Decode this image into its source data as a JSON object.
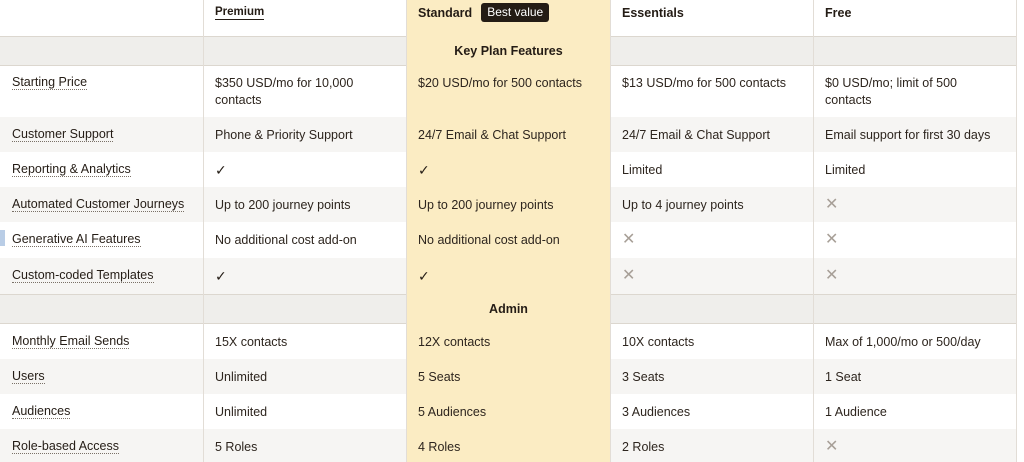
{
  "columns": {
    "premium": "Premium",
    "standard": "Standard",
    "standard_badge": "Best value",
    "essentials": "Essentials",
    "free": "Free"
  },
  "sections": {
    "key_plan_features": "Key Plan Features",
    "admin": "Admin"
  },
  "rows": [
    {
      "feature": "Starting Price",
      "premium": "$350 USD/mo for 10,000 contacts",
      "standard": "$20 USD/mo for 500 contacts",
      "essentials": "$13 USD/mo for 500 contacts",
      "free": "$0 USD/mo; limit of 500 contacts"
    },
    {
      "feature": "Customer Support",
      "premium": "Phone & Priority Support",
      "standard": "24/7 Email & Chat Support",
      "essentials": "24/7 Email & Chat Support",
      "free": "Email support for first 30 days"
    },
    {
      "feature": "Reporting & Analytics",
      "premium": "✓",
      "standard": "✓",
      "essentials": "Limited",
      "free": "Limited"
    },
    {
      "feature": "Automated Customer Journeys",
      "premium": "Up to 200 journey points",
      "standard": "Up to 200 journey points",
      "essentials": "Up to 4 journey points",
      "free": "✕"
    },
    {
      "feature": "Generative AI Features",
      "premium": "No additional cost add-on",
      "standard": "No additional cost add-on",
      "essentials": "✕",
      "free": "✕"
    },
    {
      "feature": "Custom-coded Templates",
      "premium": "✓",
      "standard": "✓",
      "essentials": "✕",
      "free": "✕"
    },
    {
      "feature": "Monthly Email Sends",
      "premium": "15X contacts",
      "standard": "12X contacts",
      "essentials": "10X contacts",
      "free": "Max of 1,000/mo or 500/day"
    },
    {
      "feature": "Users",
      "premium": "Unlimited",
      "standard": "5 Seats",
      "essentials": "3 Seats",
      "free": "1 Seat"
    },
    {
      "feature": "Audiences",
      "premium": "Unlimited",
      "standard": "5 Audiences",
      "essentials": "3 Audiences",
      "free": "1 Audience"
    },
    {
      "feature": "Role-based Access",
      "premium": "5 Roles",
      "standard": "4 Roles",
      "essentials": "2 Roles",
      "free": "✕"
    }
  ],
  "icons": {
    "check": "check-icon",
    "cross": "cross-icon"
  },
  "colors": {
    "standard_highlight": "#fbecc3",
    "badge_bg": "#241c15",
    "text": "#241c15",
    "cross": "#a79f97"
  }
}
